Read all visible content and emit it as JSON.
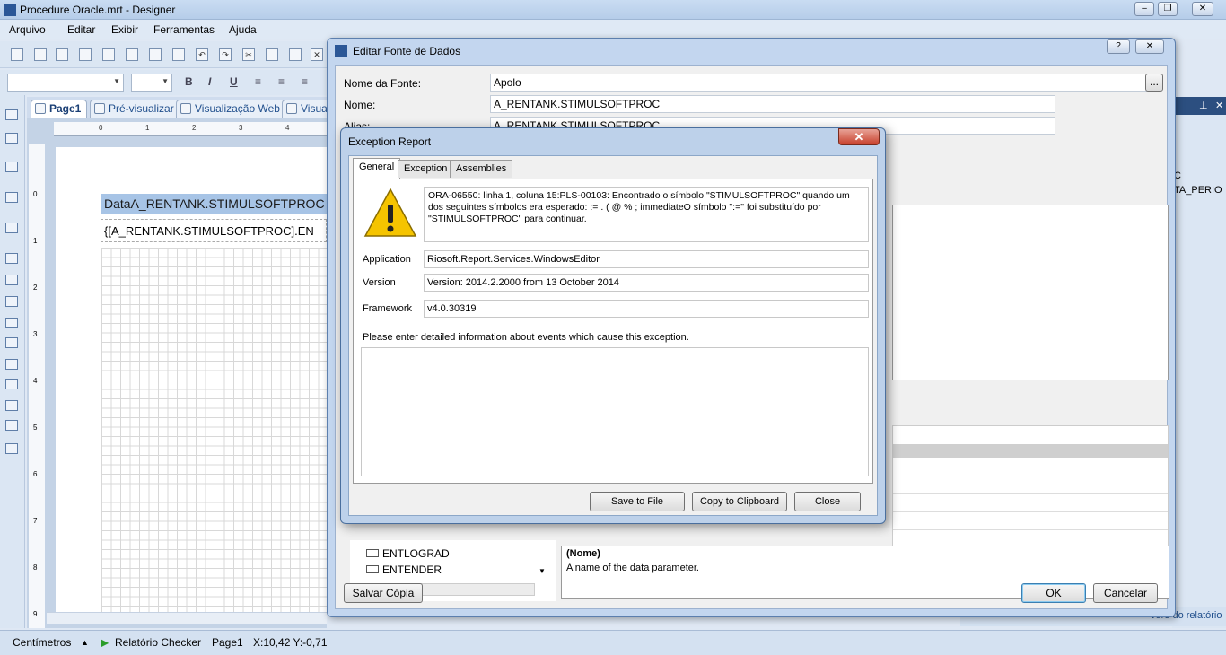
{
  "window": {
    "title": "Procedure Oracle.mrt - Designer"
  },
  "menu": [
    "Arquivo",
    "Editar",
    "Exibir",
    "Ferramentas",
    "Ajuda"
  ],
  "tabs": [
    {
      "label": "Page1",
      "icon": "page-icon"
    },
    {
      "label": "Pré-visualizar",
      "icon": "preview-icon"
    },
    {
      "label": "Visualização Web",
      "icon": "web-preview-icon"
    },
    {
      "label": "Visua",
      "icon": "zoom-icon"
    }
  ],
  "design": {
    "ruler_h": [
      "0",
      "1",
      "2",
      "3",
      "4"
    ],
    "ruler_v": [
      "0",
      "1",
      "2",
      "3",
      "4",
      "5",
      "6",
      "7",
      "8",
      "9"
    ],
    "data_band": "DataA_RENTANK.STIMULSOFTPROC",
    "data_field": "{[A_RENTANK.STIMULSOFTPROC].EN"
  },
  "status": {
    "units": "Centímetros",
    "checker": "Relatório Checker",
    "page": "Page1",
    "coords": "X:10,42  Y:-0,71"
  },
  "right_pane": {
    "partial_1": "C",
    "partial_2": "TA_PERIO",
    "bottom_partial": "vore do relatório"
  },
  "ds_dialog": {
    "title": "Editar Fonte de Dados",
    "fields": [
      {
        "label": "Nome da Fonte:",
        "value": "Apolo"
      },
      {
        "label": "Nome:",
        "value": "A_RENTANK.STIMULSOFTPROC"
      },
      {
        "label": "Alias:",
        "value": "A_RENTANK.STIMULSOFTPROC"
      }
    ],
    "browse_label": "...",
    "tree_items": [
      "ENTLOGRAD",
      "ENTENDER"
    ],
    "desc_title": "(Nome)",
    "desc_text": "A name of the data parameter.",
    "save_copy": "Salvar Cópia",
    "ok": "OK",
    "cancel": "Cancelar"
  },
  "exception": {
    "title": "Exception Report",
    "close": "✕",
    "tabs": [
      "General",
      "Exception",
      "Assemblies"
    ],
    "message": "ORA-06550: linha 1, coluna 15:PLS-00103: Encontrado o símbolo \"STIMULSOFTPROC\" quando um dos seguintes símbolos era esperado:   := . ( @ % ; immediateO símbolo \":=\" foi substituído por \"STIMULSOFTPROC\" para continuar.",
    "application_label": "Application",
    "application": "Riosoft.Report.Services.WindowsEditor",
    "version_label": "Version",
    "version": "Version: 2014.2.2000 from 13 October 2014",
    "framework_label": "Framework",
    "framework": "v4.0.30319",
    "info_prompt": "Please enter detailed information about events which cause this exception.",
    "buttons": {
      "save": "Save to File",
      "copy": "Copy to Clipboard",
      "close": "Close"
    }
  }
}
